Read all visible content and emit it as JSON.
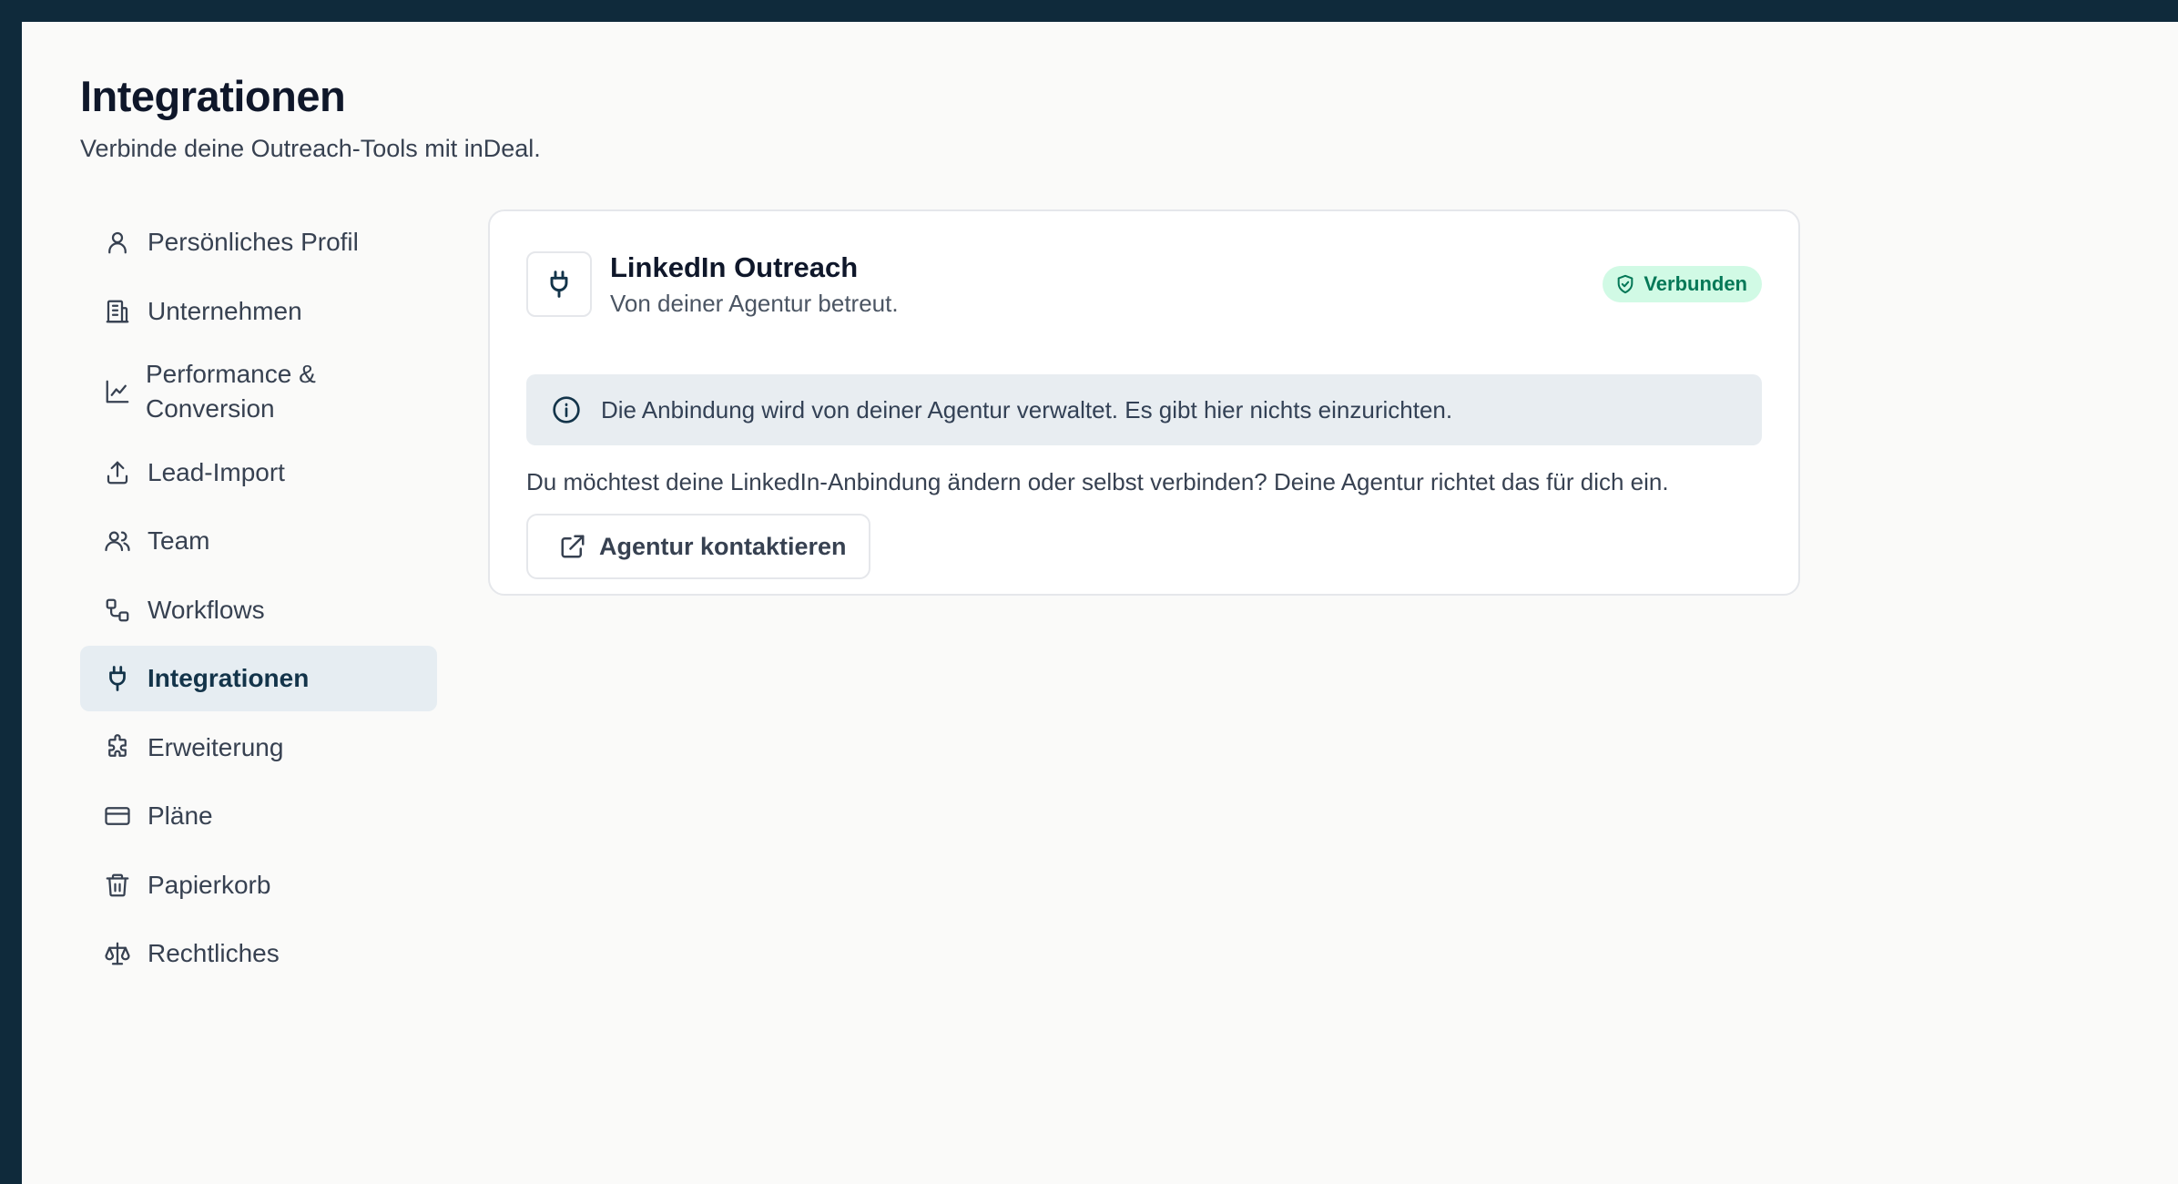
{
  "header": {
    "title": "Integrationen",
    "subtitle": "Verbinde deine Outreach-Tools mit inDeal."
  },
  "sidebar": {
    "items": [
      {
        "label": "Persönliches Profil",
        "icon": "user-icon",
        "active": false
      },
      {
        "label": "Unternehmen",
        "icon": "building-icon",
        "active": false
      },
      {
        "label": "Performance & Conversion",
        "icon": "chart-line-icon",
        "active": false
      },
      {
        "label": "Lead-Import",
        "icon": "upload-icon",
        "active": false
      },
      {
        "label": "Team",
        "icon": "users-icon",
        "active": false
      },
      {
        "label": "Workflows",
        "icon": "workflow-icon",
        "active": false
      },
      {
        "label": "Integrationen",
        "icon": "plug-icon",
        "active": true
      },
      {
        "label": "Erweiterung",
        "icon": "puzzle-icon",
        "active": false
      },
      {
        "label": "Pläne",
        "icon": "credit-card-icon",
        "active": false
      },
      {
        "label": "Papierkorb",
        "icon": "trash-icon",
        "active": false
      },
      {
        "label": "Rechtliches",
        "icon": "scale-icon",
        "active": false
      }
    ]
  },
  "integration": {
    "name": "LinkedIn Outreach",
    "description": "Von deiner Agentur betreut.",
    "status": "Verbunden",
    "status_color": "#047857",
    "info": "Die Anbindung wird von deiner Agentur verwaltet. Es gibt hier nichts einzurichten.",
    "help": "Du möchtest deine LinkedIn-Anbindung ändern oder selbst verbinden? Deine Agentur richtet das für dich ein.",
    "contact_label": "Agentur kontaktieren"
  },
  "colors": {
    "frame": "#0f2a3b",
    "background": "#fafaf9",
    "accent": "#13344a",
    "active_bg": "#e6edf2",
    "success_bg": "#d1fae5"
  }
}
